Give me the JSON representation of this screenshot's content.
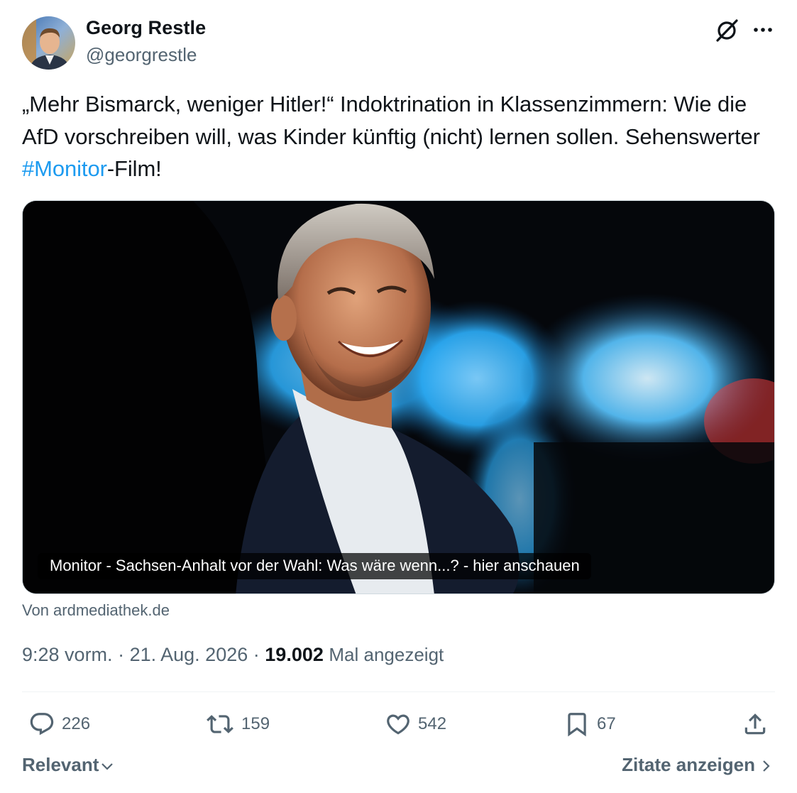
{
  "author": {
    "name": "Georg Restle",
    "handle": "@georgrestle"
  },
  "icons": {
    "grok": "grok-icon",
    "more": "more-dots-icon",
    "reply": "reply-icon",
    "retweet": "retweet-icon",
    "like": "heart-icon",
    "bookmark": "bookmark-icon",
    "share": "share-icon"
  },
  "tweet": {
    "text_before": "„Mehr Bismarck, weniger Hitler!“ Indoktrination in Klassenzimmern: Wie die AfD vorschreiben will, was Kinder künftig (nicht) lernen sollen. Sehenswerter ",
    "hashtag": "#Monitor",
    "text_after": "-Film!"
  },
  "card": {
    "caption": "Monitor - Sachsen-Anhalt vor der Wahl: Was wäre wenn...? - hier anschauen",
    "source": "Von ardmediathek.de"
  },
  "meta": {
    "time": "9:28 vorm.",
    "separator": "·",
    "date": "21. Aug. 2026",
    "views_count": "19.002",
    "views_label": "Mal angezeigt"
  },
  "actions": {
    "replies": "226",
    "retweets": "159",
    "likes": "542",
    "bookmarks": "67"
  },
  "footer": {
    "sort_label": "Relevant",
    "quotes_label": "Zitate anzeigen"
  },
  "colors": {
    "text": "#0f1419",
    "muted": "#536471",
    "link": "#1d9bf0",
    "divider": "#eff3f4"
  }
}
